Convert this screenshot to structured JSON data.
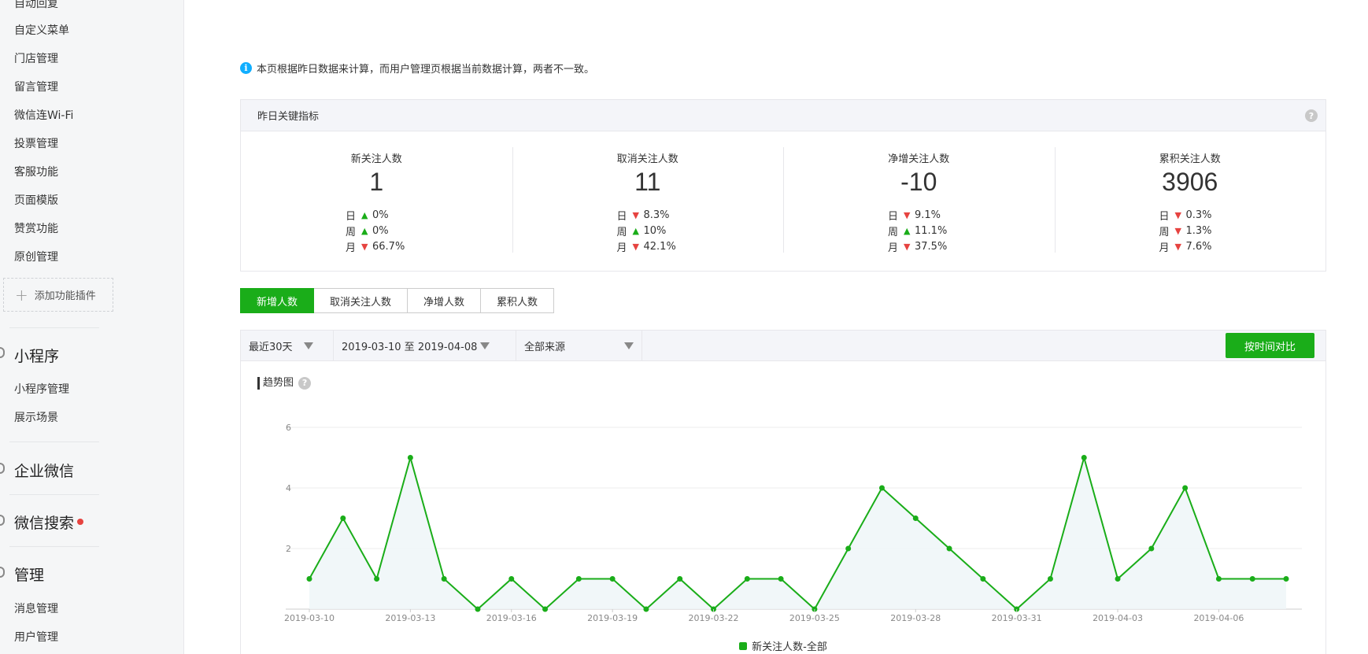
{
  "sidebar": {
    "items": [
      "自动回复",
      "自定义菜单",
      "门店管理",
      "留言管理",
      "微信连Wi-Fi",
      "投票管理",
      "客服功能",
      "页面模版",
      "赞赏功能",
      "原创管理"
    ],
    "add_plugin": "添加功能插件",
    "mini_program": {
      "title": "小程序",
      "items": [
        "小程序管理",
        "展示场景"
      ]
    },
    "enterprise": {
      "title": "企业微信"
    },
    "search": {
      "title": "微信搜索"
    },
    "manage": {
      "title": "管理",
      "items": [
        "消息管理",
        "用户管理"
      ]
    }
  },
  "notice": "本页根据昨日数据来计算，而用户管理页根据当前数据计算，两者不一致。",
  "kpi": {
    "header": "昨日关键指标",
    "row_labels": [
      "日",
      "周",
      "月"
    ],
    "cards": [
      {
        "title": "新关注人数",
        "value": "1",
        "changes": [
          {
            "dir": "up",
            "pct": "0%"
          },
          {
            "dir": "up",
            "pct": "0%"
          },
          {
            "dir": "down",
            "pct": "66.7%"
          }
        ]
      },
      {
        "title": "取消关注人数",
        "value": "11",
        "changes": [
          {
            "dir": "down",
            "pct": "8.3%"
          },
          {
            "dir": "up",
            "pct": "10%"
          },
          {
            "dir": "down",
            "pct": "42.1%"
          }
        ]
      },
      {
        "title": "净增关注人数",
        "value": "-10",
        "changes": [
          {
            "dir": "down",
            "pct": "9.1%"
          },
          {
            "dir": "up",
            "pct": "11.1%"
          },
          {
            "dir": "down",
            "pct": "37.5%"
          }
        ]
      },
      {
        "title": "累积关注人数",
        "value": "3906",
        "changes": [
          {
            "dir": "down",
            "pct": "0.3%"
          },
          {
            "dir": "down",
            "pct": "1.3%"
          },
          {
            "dir": "down",
            "pct": "7.6%"
          }
        ]
      }
    ]
  },
  "tabs": [
    "新增人数",
    "取消关注人数",
    "净增人数",
    "累积人数"
  ],
  "active_tab": 0,
  "filters": {
    "period": "最近30天",
    "date_range": "2019-03-10 至 2019-04-08",
    "source": "全部来源",
    "compare_button": "按时间对比"
  },
  "chart_title": "趋势图",
  "colors": {
    "accent": "#1aad19",
    "up": "#1aad19",
    "down": "#e64340",
    "line": "#1aad19"
  },
  "chart_data": {
    "type": "line",
    "x": [
      "2019-03-10",
      "2019-03-11",
      "2019-03-12",
      "2019-03-13",
      "2019-03-14",
      "2019-03-15",
      "2019-03-16",
      "2019-03-17",
      "2019-03-18",
      "2019-03-19",
      "2019-03-20",
      "2019-03-21",
      "2019-03-22",
      "2019-03-23",
      "2019-03-24",
      "2019-03-25",
      "2019-03-26",
      "2019-03-27",
      "2019-03-28",
      "2019-03-29",
      "2019-03-30",
      "2019-03-31",
      "2019-04-01",
      "2019-04-02",
      "2019-04-03",
      "2019-04-04",
      "2019-04-05",
      "2019-04-06",
      "2019-04-07",
      "2019-04-08"
    ],
    "x_tick_labels": [
      "2019-03-10",
      "2019-03-13",
      "2019-03-16",
      "2019-03-19",
      "2019-03-22",
      "2019-03-25",
      "2019-03-28",
      "2019-03-31",
      "2019-04-03",
      "2019-04-06"
    ],
    "series": [
      {
        "name": "新关注人数-全部",
        "values": [
          1,
          3,
          1,
          5,
          1,
          0,
          1,
          0,
          1,
          1,
          0,
          1,
          0,
          1,
          1,
          0,
          2,
          4,
          3,
          2,
          1,
          0,
          1,
          5,
          1,
          2,
          4,
          1,
          1,
          1
        ]
      }
    ],
    "y_ticks": [
      2,
      4,
      6
    ],
    "ylim": [
      0,
      6
    ],
    "grid": true,
    "area_fill": true,
    "legend": "bottom-center"
  }
}
